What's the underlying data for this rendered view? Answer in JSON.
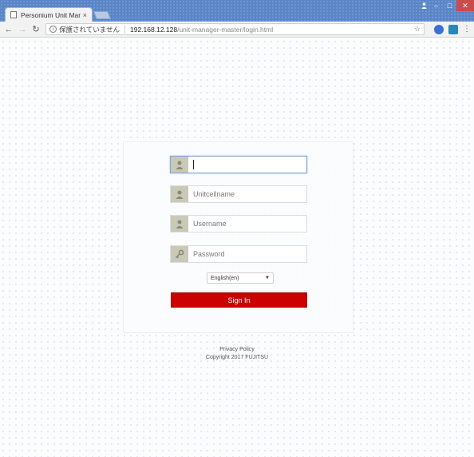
{
  "browser": {
    "tab": {
      "title": "Personium Unit Mana",
      "close": "×"
    },
    "address": {
      "security_text": "保護されていません",
      "host": "192.168.12.128",
      "path": "/unit-manager-master/login.html"
    }
  },
  "login": {
    "fields": [
      {
        "name": "first-input",
        "placeholder": "",
        "icon": "user-icon"
      },
      {
        "name": "unitcellname-input",
        "placeholder": "Unitcellname",
        "icon": "user-icon"
      },
      {
        "name": "username-input",
        "placeholder": "Username",
        "icon": "user-icon"
      },
      {
        "name": "password-input",
        "placeholder": "Password",
        "icon": "key-icon"
      }
    ],
    "language": {
      "selected": "English(en)"
    },
    "signin_label": "Sign In"
  },
  "footer": {
    "privacy": "Privacy Policy",
    "copyright": "Copyright 2017 FUJITSU"
  },
  "colors": {
    "tabstrip": "#5a86c8",
    "signin_button": "#cc0000",
    "field_icon_bg": "#c9c9b6"
  }
}
